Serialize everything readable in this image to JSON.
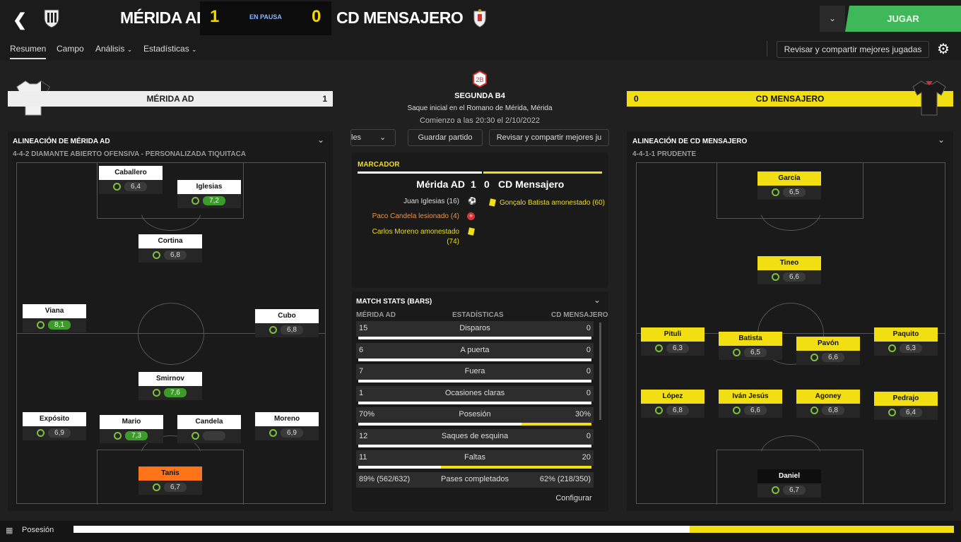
{
  "header": {
    "home": "MÉRIDA AD",
    "away": "CD MENSAJERO",
    "home_score": "1",
    "away_score": "0",
    "status": "EN PAUSA",
    "play": "JUGAR"
  },
  "nav": {
    "tabs": [
      "Resumen",
      "Campo",
      "Análisis",
      "Estadísticas"
    ],
    "review": "Revisar y compartir mejores jugadas"
  },
  "home_bar": {
    "name": "MÉRIDA AD",
    "score": "1"
  },
  "away_bar": {
    "name": "CD MENSAJERO",
    "score": "0"
  },
  "match": {
    "competition": "SEGUNDA B4",
    "venue": "Saque inicial en el Romano de Mérida, Mérida",
    "kickoff": "Comienzo a las 20:30 el 2/10/2022",
    "btn_left": "les",
    "btn_save": "Guardar partido",
    "btn_review": "Revisar y compartir mejores ju"
  },
  "scoreboard": {
    "title": "MARCADOR",
    "home": "Mérida AD",
    "home_score": "1",
    "away_score": "0",
    "away": "CD Mensajero",
    "events_home": [
      "Juan Iglesias (16)",
      "Paco Candela lesionado (4)",
      "Carlos Moreno amonestado (74)"
    ],
    "events_away": [
      "Gonçalo Batista amonestado (60)"
    ]
  },
  "stats": {
    "title": "MATCH STATS (BARS)",
    "col_home": "MÉRIDA AD",
    "col_mid": "ESTADÍSTICAS",
    "col_away": "CD MENSAJERO",
    "configure": "Configurar",
    "rows": [
      {
        "l": "15",
        "c": "Disparos",
        "r": "0",
        "pct": 1
      },
      {
        "l": "6",
        "c": "A puerta",
        "r": "0",
        "pct": 1
      },
      {
        "l": "7",
        "c": "Fuera",
        "r": "0",
        "pct": 1
      },
      {
        "l": "1",
        "c": "Ocasiones claras",
        "r": "0",
        "pct": 1
      },
      {
        "l": "70%",
        "c": "Posesión",
        "r": "30%",
        "pct": 0.7
      },
      {
        "l": "12",
        "c": "Saques de esquina",
        "r": "0",
        "pct": 1
      },
      {
        "l": "11",
        "c": "Faltas",
        "r": "20",
        "pct": 0.355
      },
      {
        "l": "89% (562/632)",
        "c": "Pases completados",
        "r": "62% (218/350)",
        "pct": null
      }
    ]
  },
  "home_lineup": {
    "title": "ALINEACIÓN DE MÉRIDA AD",
    "formation": "4-4-2 DIAMANTE ABIERTO OFENSIVA - PERSONALIZADA TIQUITACA",
    "players": [
      {
        "n": "Caballero",
        "r": "6,4",
        "g": false
      },
      {
        "n": "Iglesias",
        "r": "7,2",
        "g": true
      },
      {
        "n": "Cortina",
        "r": "6,8",
        "g": false
      },
      {
        "n": "Viana",
        "r": "8,1",
        "g": true
      },
      {
        "n": "Cubo",
        "r": "6,8",
        "g": false
      },
      {
        "n": "Smirnov",
        "r": "7,6",
        "g": true
      },
      {
        "n": "Expósito",
        "r": "6,9",
        "g": false
      },
      {
        "n": "Mario",
        "r": "7,3",
        "g": true
      },
      {
        "n": "Candela",
        "r": "",
        "g": false
      },
      {
        "n": "Moreno",
        "r": "6,9",
        "g": false
      },
      {
        "n": "Tanis",
        "r": "6,7",
        "g": false
      }
    ]
  },
  "away_lineup": {
    "title": "ALINEACIÓN DE CD MENSAJERO",
    "formation": "4-4-1-1 PRUDENTE",
    "players": [
      {
        "n": "García",
        "r": "6,5"
      },
      {
        "n": "Tineo",
        "r": "6,6"
      },
      {
        "n": "Pituli",
        "r": "6,3"
      },
      {
        "n": "Batista",
        "r": "6,5"
      },
      {
        "n": "Pavón",
        "r": "6,6"
      },
      {
        "n": "Paquito",
        "r": "6,3"
      },
      {
        "n": "López",
        "r": "6,8"
      },
      {
        "n": "Iván Jesús",
        "r": "6,6"
      },
      {
        "n": "Agoney",
        "r": "6,8"
      },
      {
        "n": "Pedrajo",
        "r": "6,4"
      },
      {
        "n": "Daniel",
        "r": "6,7"
      }
    ]
  },
  "possession": {
    "label": "Posesión",
    "home": 0.7
  },
  "colors": {
    "accent_yellow": "#f2df13",
    "green": "#3fb85a",
    "orange": "#ff7418"
  }
}
